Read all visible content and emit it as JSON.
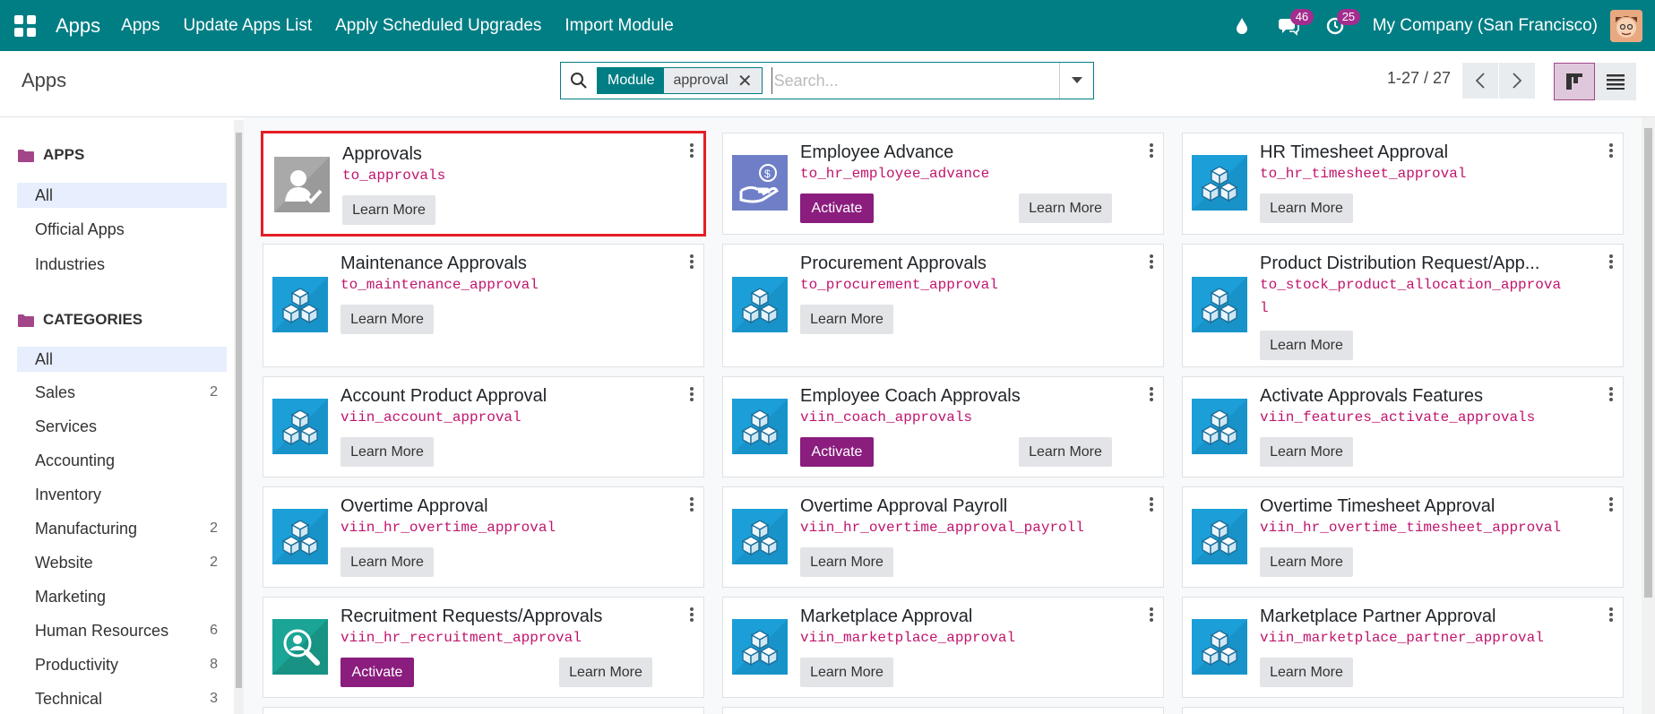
{
  "navbar": {
    "brand": "Apps",
    "links": [
      "Apps",
      "Update Apps List",
      "Apply Scheduled Upgrades",
      "Import Module"
    ],
    "chat_badge": "46",
    "activity_badge": "25",
    "company": "My Company (San Francisco)"
  },
  "control": {
    "breadcrumb": "Apps",
    "facet_label": "Module",
    "facet_value": "approval",
    "search_placeholder": "Search...",
    "pager": "1-27 / 27"
  },
  "sidebar": {
    "apps_heading": "APPS",
    "apps_items": [
      {
        "label": "All",
        "count": ""
      },
      {
        "label": "Official Apps",
        "count": ""
      },
      {
        "label": "Industries",
        "count": ""
      }
    ],
    "categories_heading": "CATEGORIES",
    "category_items": [
      {
        "label": "All",
        "count": ""
      },
      {
        "label": "Sales",
        "count": "2"
      },
      {
        "label": "Services",
        "count": ""
      },
      {
        "label": "Accounting",
        "count": ""
      },
      {
        "label": "Inventory",
        "count": ""
      },
      {
        "label": "Manufacturing",
        "count": "2"
      },
      {
        "label": "Website",
        "count": "2"
      },
      {
        "label": "Marketing",
        "count": ""
      },
      {
        "label": "Human Resources",
        "count": "6"
      },
      {
        "label": "Productivity",
        "count": "8"
      },
      {
        "label": "Technical",
        "count": "3"
      }
    ]
  },
  "buttons": {
    "learn_more": "Learn More",
    "activate": "Activate"
  },
  "cards": [
    {
      "name": "Approvals",
      "tech": "to_approvals",
      "activate": false,
      "icon": "approvals-icon"
    },
    {
      "name": "Employee Advance",
      "tech": "to_hr_employee_advance",
      "activate": true,
      "icon": "employee-advance-icon"
    },
    {
      "name": "HR Timesheet Approval",
      "tech": "to_hr_timesheet_approval",
      "activate": false,
      "icon": "module-cube-icon"
    },
    {
      "name": "Maintenance Approvals",
      "tech": "to_maintenance_approval",
      "activate": false,
      "icon": "module-cube-icon"
    },
    {
      "name": "Procurement Approvals",
      "tech": "to_procurement_approval",
      "activate": false,
      "icon": "module-cube-icon"
    },
    {
      "name": "Product Distribution Request/App...",
      "tech": "to_stock_product_allocation_approva",
      "tech2": "l",
      "activate": false,
      "icon": "module-cube-icon"
    },
    {
      "name": "Account Product Approval",
      "tech": "viin_account_approval",
      "activate": false,
      "icon": "module-cube-icon"
    },
    {
      "name": "Employee Coach Approvals",
      "tech": "viin_coach_approvals",
      "activate": true,
      "icon": "module-cube-icon"
    },
    {
      "name": "Activate Approvals Features",
      "tech": "viin_features_activate_approvals",
      "activate": false,
      "icon": "module-cube-icon"
    },
    {
      "name": "Overtime Approval",
      "tech": "viin_hr_overtime_approval",
      "activate": false,
      "icon": "module-cube-icon"
    },
    {
      "name": "Overtime Approval Payroll",
      "tech": "viin_hr_overtime_approval_payroll",
      "activate": false,
      "icon": "module-cube-icon"
    },
    {
      "name": "Overtime Timesheet Approval",
      "tech": "viin_hr_overtime_timesheet_approval",
      "activate": false,
      "icon": "module-cube-icon"
    },
    {
      "name": "Recruitment Requests/Approvals",
      "tech": "viin_hr_recruitment_approval",
      "activate": true,
      "icon": "recruitment-icon"
    },
    {
      "name": "Marketplace Approval",
      "tech": "viin_marketplace_approval",
      "activate": false,
      "icon": "module-cube-icon"
    },
    {
      "name": "Marketplace Partner Approval",
      "tech": "viin_marketplace_partner_approval",
      "activate": false,
      "icon": "module-cube-icon"
    }
  ]
}
